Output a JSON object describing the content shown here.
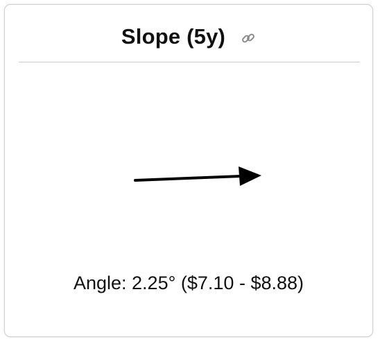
{
  "widget": {
    "title": "Slope (5y)",
    "link_icon": "link-icon",
    "angle_label": "Angle: 2.25° ($7.10 - $8.88)",
    "angle_degrees": 2.25,
    "arrow_color": "#000000"
  }
}
